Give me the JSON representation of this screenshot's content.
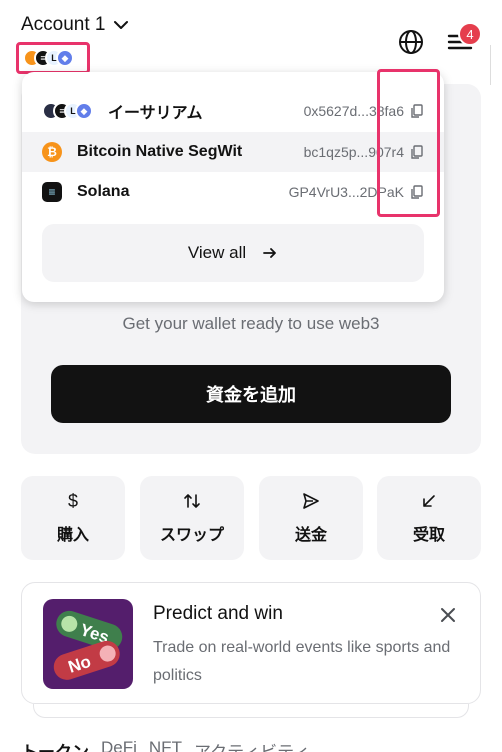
{
  "header": {
    "account_name": "Account 1",
    "notification_count": "4",
    "chain_icons": [
      "bitcoin-icon",
      "solana-icon",
      "linea-icon",
      "ethereum-icon"
    ]
  },
  "accounts": [
    {
      "name": "イーサリアム",
      "address": "0x5627d...38fa6",
      "icon": "ethereum-multi-icon"
    },
    {
      "name": "Bitcoin Native SegWit",
      "address": "bc1qz5p...907r4",
      "icon": "bitcoin-icon"
    },
    {
      "name": "Solana",
      "address": "GP4VrU3...2DPaK",
      "icon": "solana-icon"
    }
  ],
  "view_all": "View all",
  "main": {
    "tagline": "Get your wallet ready to use web3",
    "add_funds": "資金を追加"
  },
  "actions": [
    {
      "label": "購入",
      "icon": "dollar-icon"
    },
    {
      "label": "スワップ",
      "icon": "swap-icon"
    },
    {
      "label": "送金",
      "icon": "send-icon"
    },
    {
      "label": "受取",
      "icon": "receive-icon"
    }
  ],
  "promo": {
    "title": "Predict and win",
    "description": "Trade on real-world events like sports and politics",
    "yes": "Yes",
    "no": "No"
  },
  "tabs": [
    "トークン",
    "DeFi",
    "NFT",
    "アクティビティ"
  ],
  "colors": {
    "accent": "#121212",
    "highlight": "#e8336b",
    "badge": "#e53e4d",
    "surface": "#f3f3f5"
  }
}
